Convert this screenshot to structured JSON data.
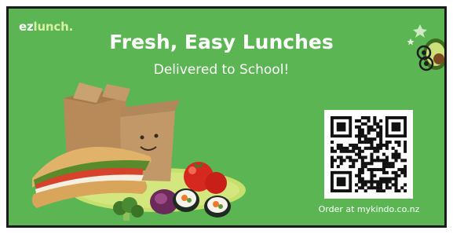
{
  "logo": {
    "part1": "ez",
    "part2": "lunch."
  },
  "headline": "Fresh, Easy Lunches",
  "subheadline": "Delivered to School!",
  "order_text": "Order at mykindo.co.nz",
  "colors": {
    "background": "#5ab552",
    "accent": "#d7f0a4",
    "text": "#ffffff"
  },
  "illustration": {
    "items": [
      "noodle-box-icon",
      "sandwich-icon",
      "tomato-icon",
      "onion-icon",
      "sushi-icon",
      "broccoli-icon"
    ]
  },
  "mascot": {
    "icon": "avocado-mascot-icon"
  },
  "qr": {
    "icon": "qr-code-icon"
  }
}
